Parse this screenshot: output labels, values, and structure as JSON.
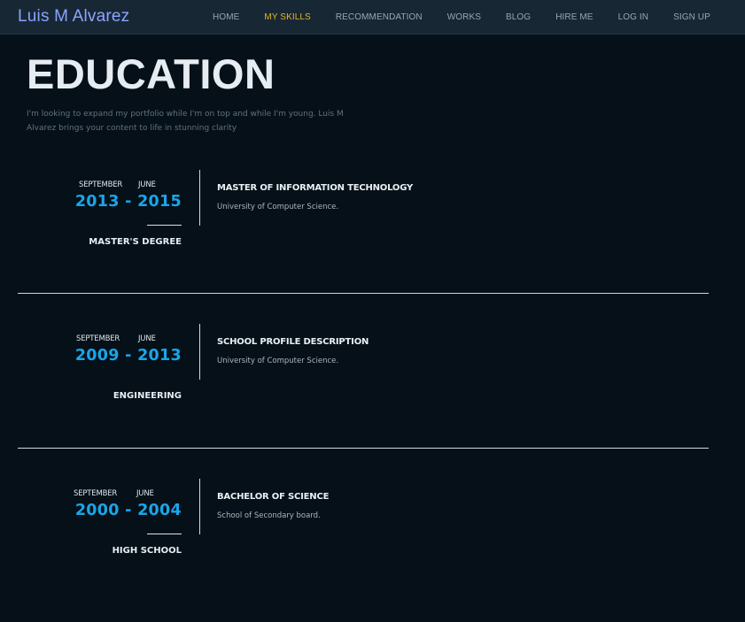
{
  "nav": {
    "brand": "Luis M Alvarez",
    "items": [
      {
        "label": "HOME"
      },
      {
        "label": "MY SKILLS"
      },
      {
        "label": "RECOMMENDATION"
      },
      {
        "label": "WORKS"
      },
      {
        "label": "BLOG"
      },
      {
        "label": "HIRE ME"
      },
      {
        "label": "LOG IN"
      },
      {
        "label": "SIGN UP"
      }
    ],
    "active_item": "MY SKILLS",
    "active_color": "#e3b323"
  },
  "section": {
    "title": "EDUCATION",
    "intro": "I'm looking to expand my portfolio while I'm on top and while I'm young. Luis M Alvarez brings your content to life in stunning clarity"
  },
  "accent_color": "#19a6ea",
  "entries": [
    {
      "start_month": "SEPTEMBER",
      "end_month": "JUNE",
      "years": "2013 - 2015",
      "degree": "MASTER'S DEGREE",
      "heading": "MASTER OF INFORMATION TECHNOLOGY",
      "school": "University of Computer Science."
    },
    {
      "start_month": "SEPTEMBER",
      "end_month": "JUNE",
      "years": "2009 - 2013",
      "degree": "ENGINEERING",
      "heading": "SCHOOL PROFILE DESCRIPTION",
      "school": "University of Computer Science."
    },
    {
      "start_month": "SEPTEMBER",
      "end_month": "JUNE",
      "years": "2000 - 2004",
      "degree": "HIGH SCHOOL",
      "heading": "BACHELOR OF SCIENCE",
      "school": "School of Secondary board."
    }
  ]
}
